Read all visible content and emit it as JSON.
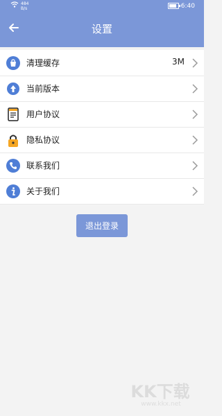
{
  "status_bar": {
    "network_speed": "484",
    "network_unit": "B/s",
    "time": "6:40",
    "battery_level": 0.85
  },
  "header": {
    "title": "设置",
    "back_icon": "arrow-left-icon"
  },
  "settings": [
    {
      "label": "清理缓存",
      "value": "3M",
      "icon": "cache-bag-icon"
    },
    {
      "label": "当前版本",
      "value": "",
      "icon": "upload-circle-icon"
    },
    {
      "label": "用户协议",
      "value": "",
      "icon": "document-icon"
    },
    {
      "label": "隐私协议",
      "value": "",
      "icon": "lock-icon"
    },
    {
      "label": "联系我们",
      "value": "",
      "icon": "phone-icon"
    },
    {
      "label": "关于我们",
      "value": "",
      "icon": "info-icon"
    }
  ],
  "actions": {
    "logout": "退出登录"
  },
  "watermark": {
    "brand": "KK下载",
    "url": "www.kkx.net"
  },
  "colors": {
    "primary": "#7b97d8",
    "icon_blue": "#4f7ed6",
    "icon_orange": "#f5a623",
    "background": "#f3f3f3"
  }
}
